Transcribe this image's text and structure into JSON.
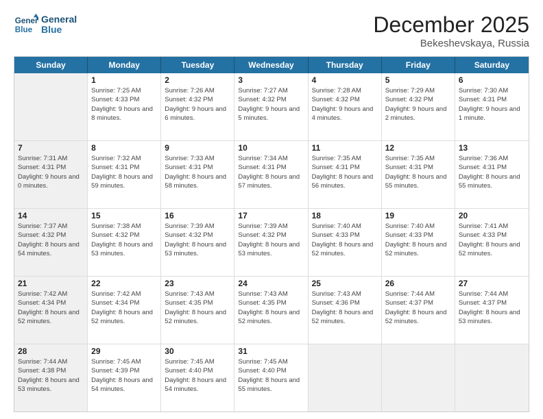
{
  "header": {
    "logo_line1": "General",
    "logo_line2": "Blue",
    "month": "December 2025",
    "location": "Bekeshevskaya, Russia"
  },
  "weekdays": [
    "Sunday",
    "Monday",
    "Tuesday",
    "Wednesday",
    "Thursday",
    "Friday",
    "Saturday"
  ],
  "rows": [
    [
      {
        "day": "",
        "sunrise": "",
        "sunset": "",
        "daylight": "",
        "shaded": true
      },
      {
        "day": "1",
        "sunrise": "Sunrise: 7:25 AM",
        "sunset": "Sunset: 4:33 PM",
        "daylight": "Daylight: 9 hours and 8 minutes.",
        "shaded": false
      },
      {
        "day": "2",
        "sunrise": "Sunrise: 7:26 AM",
        "sunset": "Sunset: 4:32 PM",
        "daylight": "Daylight: 9 hours and 6 minutes.",
        "shaded": false
      },
      {
        "day": "3",
        "sunrise": "Sunrise: 7:27 AM",
        "sunset": "Sunset: 4:32 PM",
        "daylight": "Daylight: 9 hours and 5 minutes.",
        "shaded": false
      },
      {
        "day": "4",
        "sunrise": "Sunrise: 7:28 AM",
        "sunset": "Sunset: 4:32 PM",
        "daylight": "Daylight: 9 hours and 4 minutes.",
        "shaded": false
      },
      {
        "day": "5",
        "sunrise": "Sunrise: 7:29 AM",
        "sunset": "Sunset: 4:32 PM",
        "daylight": "Daylight: 9 hours and 2 minutes.",
        "shaded": false
      },
      {
        "day": "6",
        "sunrise": "Sunrise: 7:30 AM",
        "sunset": "Sunset: 4:31 PM",
        "daylight": "Daylight: 9 hours and 1 minute.",
        "shaded": false
      }
    ],
    [
      {
        "day": "7",
        "sunrise": "Sunrise: 7:31 AM",
        "sunset": "Sunset: 4:31 PM",
        "daylight": "Daylight: 9 hours and 0 minutes.",
        "shaded": true
      },
      {
        "day": "8",
        "sunrise": "Sunrise: 7:32 AM",
        "sunset": "Sunset: 4:31 PM",
        "daylight": "Daylight: 8 hours and 59 minutes.",
        "shaded": false
      },
      {
        "day": "9",
        "sunrise": "Sunrise: 7:33 AM",
        "sunset": "Sunset: 4:31 PM",
        "daylight": "Daylight: 8 hours and 58 minutes.",
        "shaded": false
      },
      {
        "day": "10",
        "sunrise": "Sunrise: 7:34 AM",
        "sunset": "Sunset: 4:31 PM",
        "daylight": "Daylight: 8 hours and 57 minutes.",
        "shaded": false
      },
      {
        "day": "11",
        "sunrise": "Sunrise: 7:35 AM",
        "sunset": "Sunset: 4:31 PM",
        "daylight": "Daylight: 8 hours and 56 minutes.",
        "shaded": false
      },
      {
        "day": "12",
        "sunrise": "Sunrise: 7:35 AM",
        "sunset": "Sunset: 4:31 PM",
        "daylight": "Daylight: 8 hours and 55 minutes.",
        "shaded": false
      },
      {
        "day": "13",
        "sunrise": "Sunrise: 7:36 AM",
        "sunset": "Sunset: 4:31 PM",
        "daylight": "Daylight: 8 hours and 55 minutes.",
        "shaded": false
      }
    ],
    [
      {
        "day": "14",
        "sunrise": "Sunrise: 7:37 AM",
        "sunset": "Sunset: 4:32 PM",
        "daylight": "Daylight: 8 hours and 54 minutes.",
        "shaded": true
      },
      {
        "day": "15",
        "sunrise": "Sunrise: 7:38 AM",
        "sunset": "Sunset: 4:32 PM",
        "daylight": "Daylight: 8 hours and 53 minutes.",
        "shaded": false
      },
      {
        "day": "16",
        "sunrise": "Sunrise: 7:39 AM",
        "sunset": "Sunset: 4:32 PM",
        "daylight": "Daylight: 8 hours and 53 minutes.",
        "shaded": false
      },
      {
        "day": "17",
        "sunrise": "Sunrise: 7:39 AM",
        "sunset": "Sunset: 4:32 PM",
        "daylight": "Daylight: 8 hours and 53 minutes.",
        "shaded": false
      },
      {
        "day": "18",
        "sunrise": "Sunrise: 7:40 AM",
        "sunset": "Sunset: 4:33 PM",
        "daylight": "Daylight: 8 hours and 52 minutes.",
        "shaded": false
      },
      {
        "day": "19",
        "sunrise": "Sunrise: 7:40 AM",
        "sunset": "Sunset: 4:33 PM",
        "daylight": "Daylight: 8 hours and 52 minutes.",
        "shaded": false
      },
      {
        "day": "20",
        "sunrise": "Sunrise: 7:41 AM",
        "sunset": "Sunset: 4:33 PM",
        "daylight": "Daylight: 8 hours and 52 minutes.",
        "shaded": false
      }
    ],
    [
      {
        "day": "21",
        "sunrise": "Sunrise: 7:42 AM",
        "sunset": "Sunset: 4:34 PM",
        "daylight": "Daylight: 8 hours and 52 minutes.",
        "shaded": true
      },
      {
        "day": "22",
        "sunrise": "Sunrise: 7:42 AM",
        "sunset": "Sunset: 4:34 PM",
        "daylight": "Daylight: 8 hours and 52 minutes.",
        "shaded": false
      },
      {
        "day": "23",
        "sunrise": "Sunrise: 7:43 AM",
        "sunset": "Sunset: 4:35 PM",
        "daylight": "Daylight: 8 hours and 52 minutes.",
        "shaded": false
      },
      {
        "day": "24",
        "sunrise": "Sunrise: 7:43 AM",
        "sunset": "Sunset: 4:35 PM",
        "daylight": "Daylight: 8 hours and 52 minutes.",
        "shaded": false
      },
      {
        "day": "25",
        "sunrise": "Sunrise: 7:43 AM",
        "sunset": "Sunset: 4:36 PM",
        "daylight": "Daylight: 8 hours and 52 minutes.",
        "shaded": false
      },
      {
        "day": "26",
        "sunrise": "Sunrise: 7:44 AM",
        "sunset": "Sunset: 4:37 PM",
        "daylight": "Daylight: 8 hours and 52 minutes.",
        "shaded": false
      },
      {
        "day": "27",
        "sunrise": "Sunrise: 7:44 AM",
        "sunset": "Sunset: 4:37 PM",
        "daylight": "Daylight: 8 hours and 53 minutes.",
        "shaded": false
      }
    ],
    [
      {
        "day": "28",
        "sunrise": "Sunrise: 7:44 AM",
        "sunset": "Sunset: 4:38 PM",
        "daylight": "Daylight: 8 hours and 53 minutes.",
        "shaded": true
      },
      {
        "day": "29",
        "sunrise": "Sunrise: 7:45 AM",
        "sunset": "Sunset: 4:39 PM",
        "daylight": "Daylight: 8 hours and 54 minutes.",
        "shaded": false
      },
      {
        "day": "30",
        "sunrise": "Sunrise: 7:45 AM",
        "sunset": "Sunset: 4:40 PM",
        "daylight": "Daylight: 8 hours and 54 minutes.",
        "shaded": false
      },
      {
        "day": "31",
        "sunrise": "Sunrise: 7:45 AM",
        "sunset": "Sunset: 4:40 PM",
        "daylight": "Daylight: 8 hours and 55 minutes.",
        "shaded": false
      },
      {
        "day": "",
        "sunrise": "",
        "sunset": "",
        "daylight": "",
        "shaded": true
      },
      {
        "day": "",
        "sunrise": "",
        "sunset": "",
        "daylight": "",
        "shaded": true
      },
      {
        "day": "",
        "sunrise": "",
        "sunset": "",
        "daylight": "",
        "shaded": true
      }
    ]
  ]
}
